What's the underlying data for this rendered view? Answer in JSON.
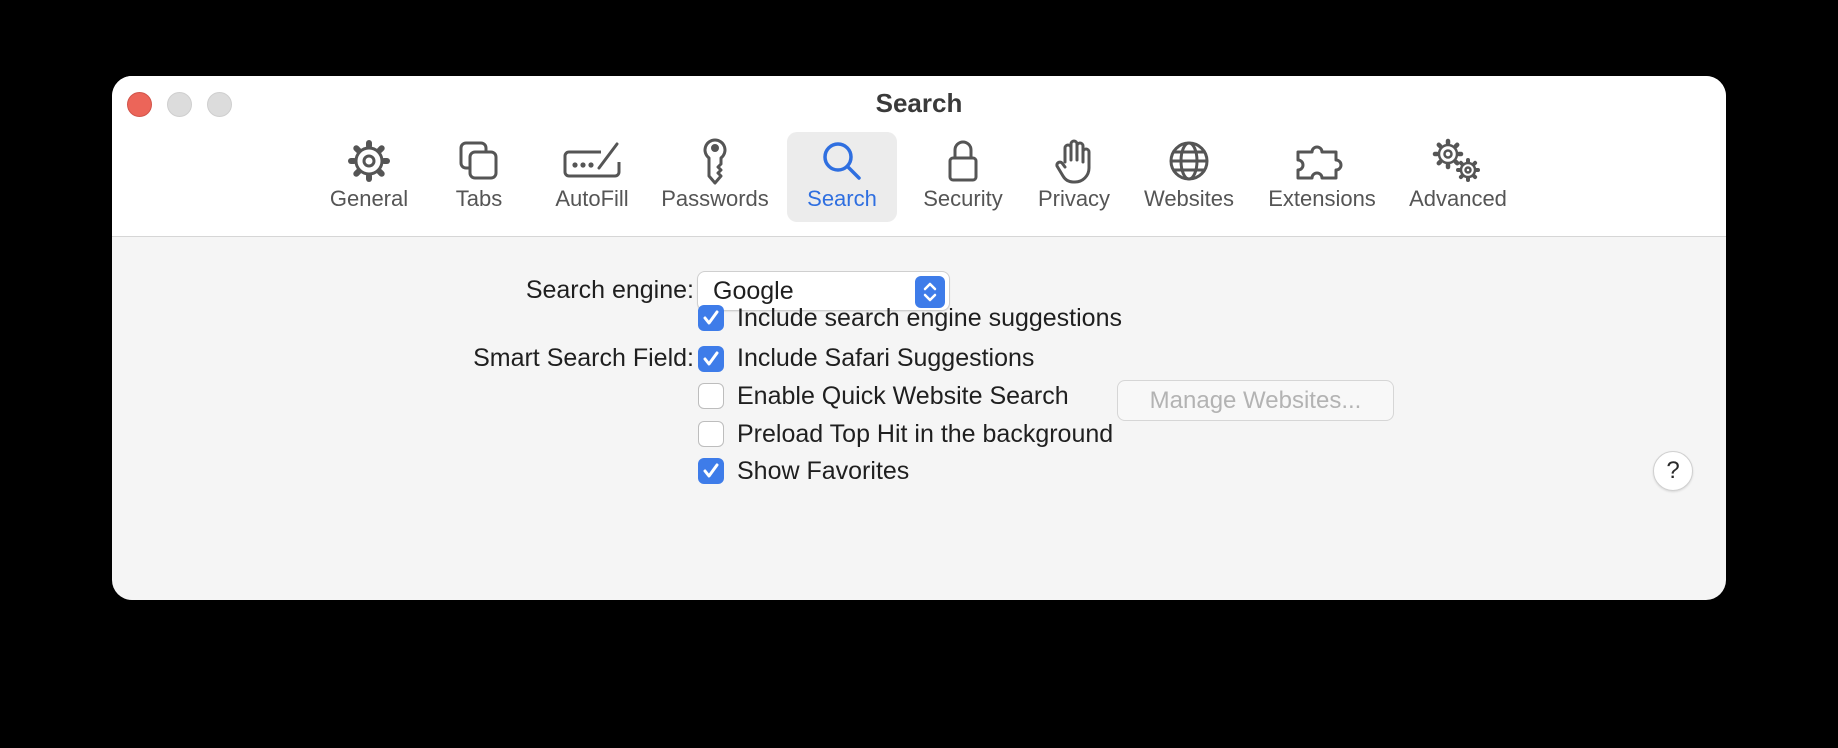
{
  "window": {
    "title": "Search"
  },
  "toolbar": {
    "items": [
      {
        "label": "General",
        "icon": "gear-icon",
        "active": false
      },
      {
        "label": "Tabs",
        "icon": "tabs-icon",
        "active": false
      },
      {
        "label": "AutoFill",
        "icon": "autofill-icon",
        "active": false
      },
      {
        "label": "Passwords",
        "icon": "key-icon",
        "active": false
      },
      {
        "label": "Search",
        "icon": "magnifier-icon",
        "active": true
      },
      {
        "label": "Security",
        "icon": "lock-icon",
        "active": false
      },
      {
        "label": "Privacy",
        "icon": "hand-icon",
        "active": false
      },
      {
        "label": "Websites",
        "icon": "globe-icon",
        "active": false
      },
      {
        "label": "Extensions",
        "icon": "puzzle-icon",
        "active": false
      },
      {
        "label": "Advanced",
        "icon": "gears-icon",
        "active": false
      }
    ]
  },
  "search_engine": {
    "label": "Search engine:",
    "selected": "Google",
    "suggestions_label": "Include search engine suggestions",
    "suggestions_checked": true
  },
  "smart_search": {
    "label": "Smart Search Field:",
    "options": [
      {
        "label": "Include Safari Suggestions",
        "checked": true
      },
      {
        "label": "Enable Quick Website Search",
        "checked": false
      },
      {
        "label": "Preload Top Hit in the background",
        "checked": false
      },
      {
        "label": "Show Favorites",
        "checked": true
      }
    ],
    "manage_button": "Manage Websites..."
  },
  "help_button": "?",
  "colors": {
    "accent": "#3e7ce9",
    "active_tab_text": "#2f6fe0",
    "close": "#ec6559"
  }
}
